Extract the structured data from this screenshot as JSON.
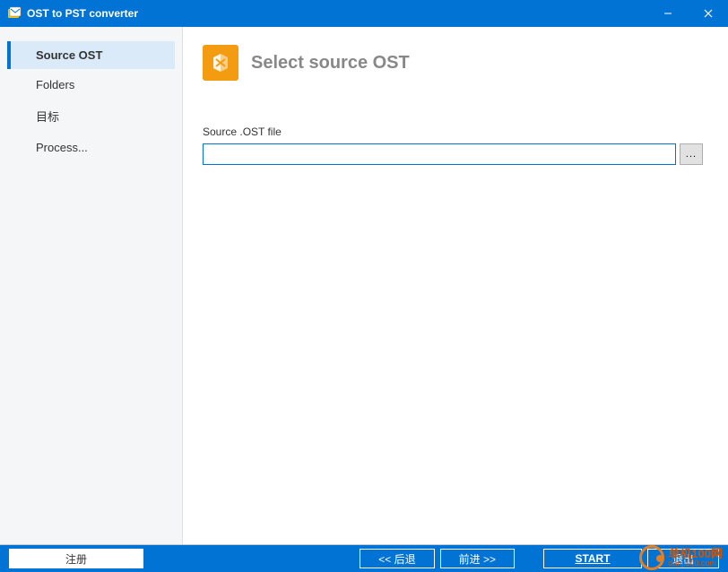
{
  "titlebar": {
    "title": "OST to PST converter"
  },
  "sidebar": {
    "items": [
      {
        "label": "Source OST",
        "active": true
      },
      {
        "label": "Folders",
        "active": false
      },
      {
        "label": "目标",
        "active": false
      },
      {
        "label": "Process...",
        "active": false
      }
    ]
  },
  "main": {
    "heading": "Select source OST",
    "field_label": "Source .OST file",
    "source_value": "",
    "browse_label": "..."
  },
  "footer": {
    "register": "注册",
    "back": "<< 后退",
    "forward": "前进 >>",
    "start": "START",
    "exit": "退出"
  },
  "watermark": {
    "cn": "单机100网",
    "en": "danji100.com"
  }
}
